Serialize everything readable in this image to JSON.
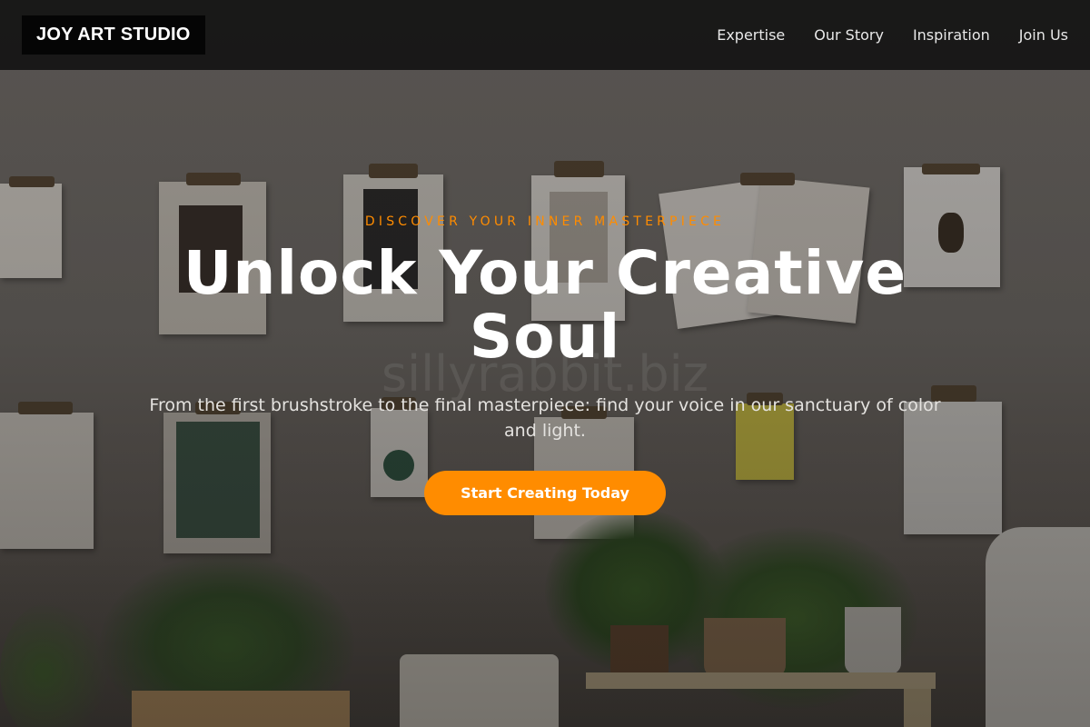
{
  "nav": {
    "logo": "JOY ART STUDIO",
    "links": [
      "Expertise",
      "Our Story",
      "Inspiration",
      "Join Us"
    ]
  },
  "hero": {
    "eyebrow": "DISCOVER YOUR INNER MASTERPIECE",
    "headline": "Unlock Your Creative Soul",
    "subtext": "From the first brushstroke to the final masterpiece: find your voice in our sanctuary of color and light.",
    "cta_label": "Start Creating Today",
    "watermark": "sillyrabbit.biz"
  },
  "colors": {
    "accent": "#ff8c00",
    "navbar": "#0f0f0f",
    "logo_bg": "#050505",
    "headline": "#ffffff"
  }
}
